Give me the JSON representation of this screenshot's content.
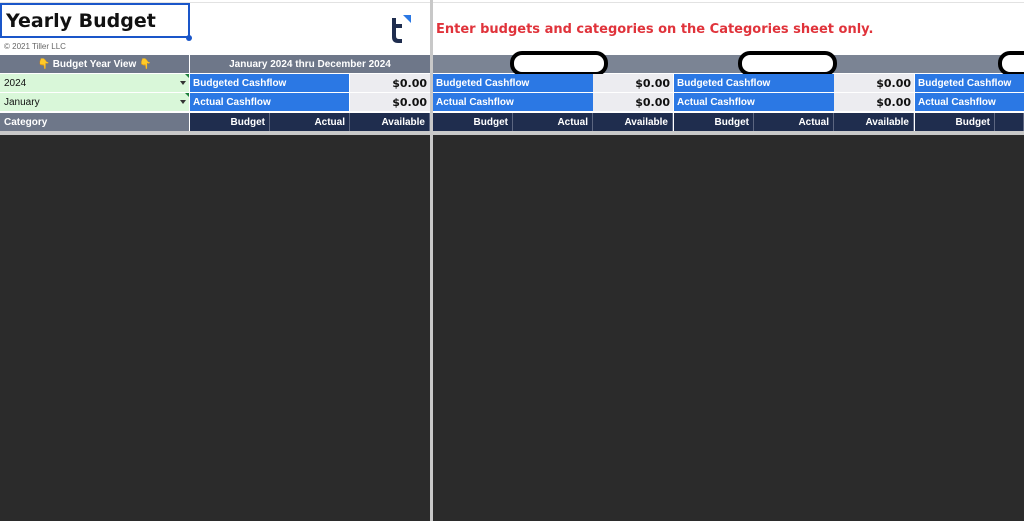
{
  "sheet": {
    "title": "Yearly Budget",
    "copyright": "© 2021 Tiller LLC",
    "logo_icon": "tiller-logo-icon",
    "instruction": "Enter budgets and categories on the Categories sheet only."
  },
  "controls": {
    "year_view_label": "👇 Budget Year View 👇",
    "year_value": "2024",
    "month_value": "January",
    "date_range": "January 2024 thru December 2024"
  },
  "summary": {
    "budgeted_cashflow_label": "Budgeted Cashflow",
    "actual_cashflow_label": "Actual Cashflow",
    "budgeted_value": "$0.00",
    "actual_value": "$0.00"
  },
  "columns": {
    "category": "Category",
    "budget": "Budget",
    "actual": "Actual",
    "available": "Available"
  },
  "monthly_blocks": [
    {
      "budgeted_label": "Budgeted Cashflow",
      "actual_label": "Actual Cashflow",
      "budgeted_value": "$0.00",
      "actual_value": "$0.00",
      "budget": "Budget",
      "actual": "Actual",
      "available": "Available"
    },
    {
      "budgeted_label": "Budgeted Cashflow",
      "actual_label": "Actual Cashflow",
      "budgeted_value": "$0.00",
      "actual_value": "$0.00",
      "budget": "Budget",
      "actual": "Actual",
      "available": "Available"
    },
    {
      "budgeted_label": "Budgeted Cashflow",
      "budget": "Budget"
    }
  ],
  "colors": {
    "accent_blue": "#2b78e4",
    "navy": "#1f2d4e",
    "slate": "#6e7789",
    "instruction_red": "#e0333b",
    "dropdown_green": "#d9f7d9"
  }
}
